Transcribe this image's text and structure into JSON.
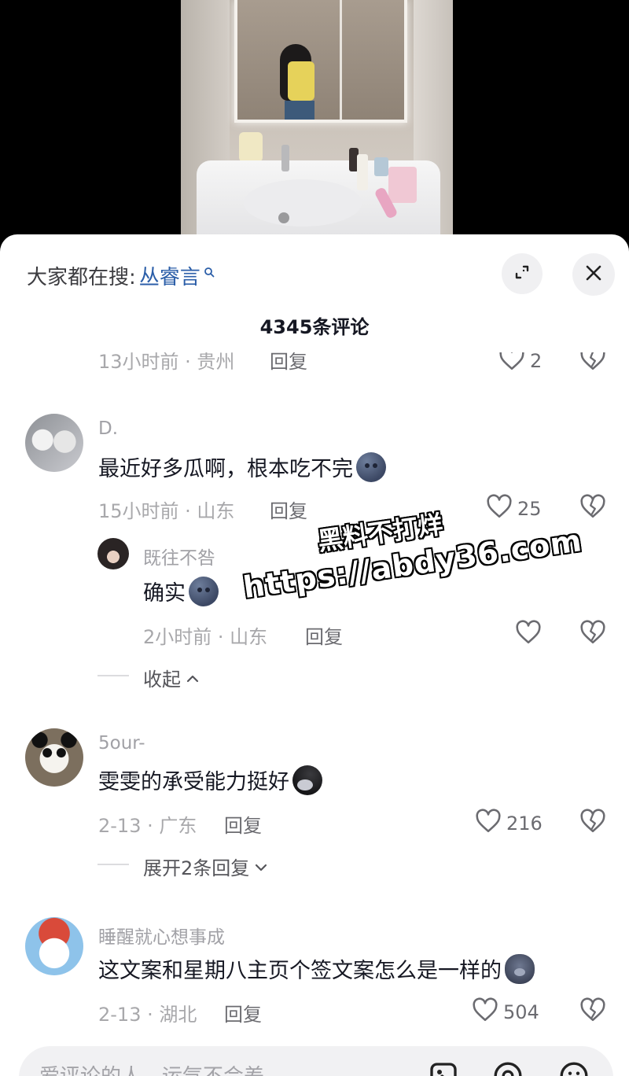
{
  "search_bar": {
    "prefix": "大家都在搜:",
    "term": "丛睿言"
  },
  "comment_count": "4345条评论",
  "comments": [
    {
      "meta_time": "13小时前 · 贵州",
      "reply_label": "回复",
      "likes": "2",
      "clipped": true
    },
    {
      "username": "D.",
      "text": "最近好多瓜啊，根本吃不完",
      "emoji": "moon-face-emoji",
      "meta_time": "15小时前 · 山东",
      "reply_label": "回复",
      "likes": "25",
      "replies": [
        {
          "username": "既往不咎",
          "text": "确实",
          "emoji": "moon-face-emoji",
          "meta_time": "2小时前 · 山东",
          "reply_label": "回复"
        }
      ],
      "toggle_label": "收起"
    },
    {
      "username": "5our-",
      "text": "雯雯的承受能力挺好",
      "emoji": "dark-face-emoji",
      "meta_time": "2-13 · 广东",
      "reply_label": "回复",
      "likes": "216",
      "toggle_label": "展开2条回复"
    },
    {
      "username": "睡醒就心想事成",
      "text": "这文案和星期八主页个签文案怎么是一样的",
      "emoji": "pig-face-emoji",
      "meta_time": "2-13 · 湖北",
      "reply_label": "回复",
      "likes": "504"
    }
  ],
  "watermark": {
    "line1": "黑料不打烊",
    "line2": "https://abdy36.com"
  },
  "input": {
    "placeholder": "爱评论的人，运气不会差"
  },
  "icons": [
    "search-mini-icon",
    "collapse-icon",
    "close-icon",
    "heart-icon",
    "dislike-heart-icon",
    "chevron-up-icon",
    "chevron-down-icon",
    "image-icon",
    "at-icon",
    "emoji-icon"
  ]
}
